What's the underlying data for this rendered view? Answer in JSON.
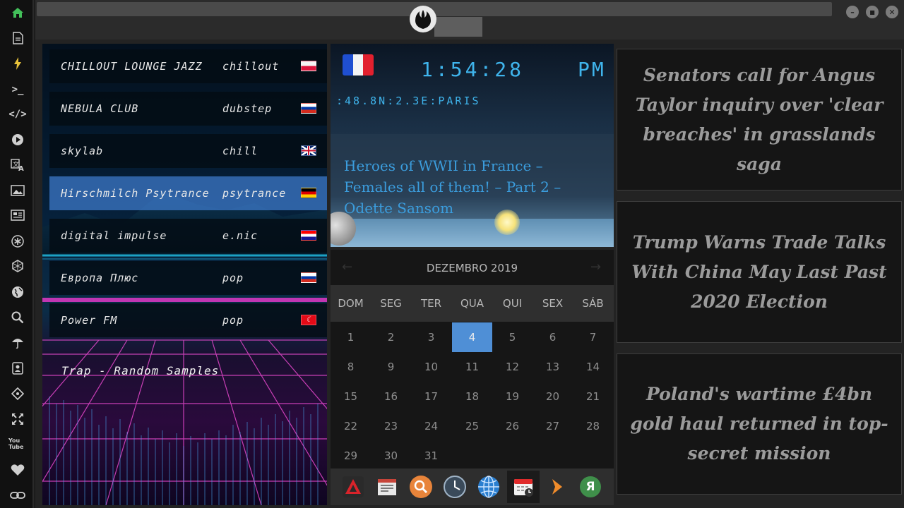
{
  "sidebar": {
    "icons": [
      "home-icon",
      "document-icon",
      "bolt-icon",
      "terminal-icon",
      "code-icon",
      "play-icon",
      "translate-icon",
      "image-icon",
      "news-icon",
      "asterisk-icon",
      "hexagon-icon",
      "globe-icon",
      "search-icon",
      "umbrella-icon",
      "contact-icon",
      "tag-icon",
      "expand-icon",
      "youtube-icon",
      "heart-icon",
      "link-icon"
    ],
    "youtube_label": "You Tube"
  },
  "window": {
    "minimize": "–",
    "maximize": "■",
    "close": "✕"
  },
  "radio": {
    "stations": [
      {
        "name": "CHILLOUT LOUNGE JAZZ",
        "genre": "chillout",
        "flag": "pl"
      },
      {
        "name": "NEBULA CLUB",
        "genre": "dubstep",
        "flag": "ru"
      },
      {
        "name": "skylab",
        "genre": "chill",
        "flag": "gb"
      },
      {
        "name": "Hirschmilch Psytrance",
        "genre": "psytrance",
        "flag": "de"
      },
      {
        "name": "digital impulse",
        "genre": "e.nic",
        "flag": "hr"
      },
      {
        "name": "Европа Плюс",
        "genre": "pop",
        "flag": "ru"
      },
      {
        "name": "Power FM",
        "genre": "pop",
        "flag": "tr"
      }
    ],
    "now_playing": "Trap - Random Samples"
  },
  "clock": {
    "time": "1:54:28",
    "ampm": "PM",
    "coords": ":48.8N:2.3E:PARIS",
    "headline": "Heroes of WWII in France – Females all of them! – Part 2 – Odette Sansom"
  },
  "calendar": {
    "title": "DEZEMBRO 2019",
    "weekdays": [
      "DOM",
      "SEG",
      "TER",
      "QUA",
      "QUI",
      "SEX",
      "SÁB"
    ],
    "days": [
      "1",
      "2",
      "3",
      "4",
      "5",
      "6",
      "7",
      "8",
      "9",
      "10",
      "11",
      "12",
      "13",
      "14",
      "15",
      "16",
      "17",
      "18",
      "19",
      "20",
      "21",
      "22",
      "23",
      "24",
      "25",
      "26",
      "27",
      "28",
      "29",
      "30",
      "31"
    ],
    "today": "4"
  },
  "dock": {
    "items": [
      "app-a-icon",
      "calendar-news-icon",
      "search-icon",
      "clock-icon",
      "globe-icon",
      "calendar-icon",
      "play-arrow-icon",
      "yandex-icon"
    ],
    "yandex_label": "Я"
  },
  "news": [
    "Senators call for Angus Taylor inquiry over 'clear breaches' in grasslands saga",
    "Trump Warns Trade Talks With China May Last Past 2020 Election",
    "Poland's wartime £4bn gold haul returned in top-secret mission"
  ],
  "colors": {
    "accent_blue": "#3fb4ec",
    "today_highlight": "#4f8fd6",
    "home_green": "#43c05a",
    "active_station": "#3c78c8"
  }
}
